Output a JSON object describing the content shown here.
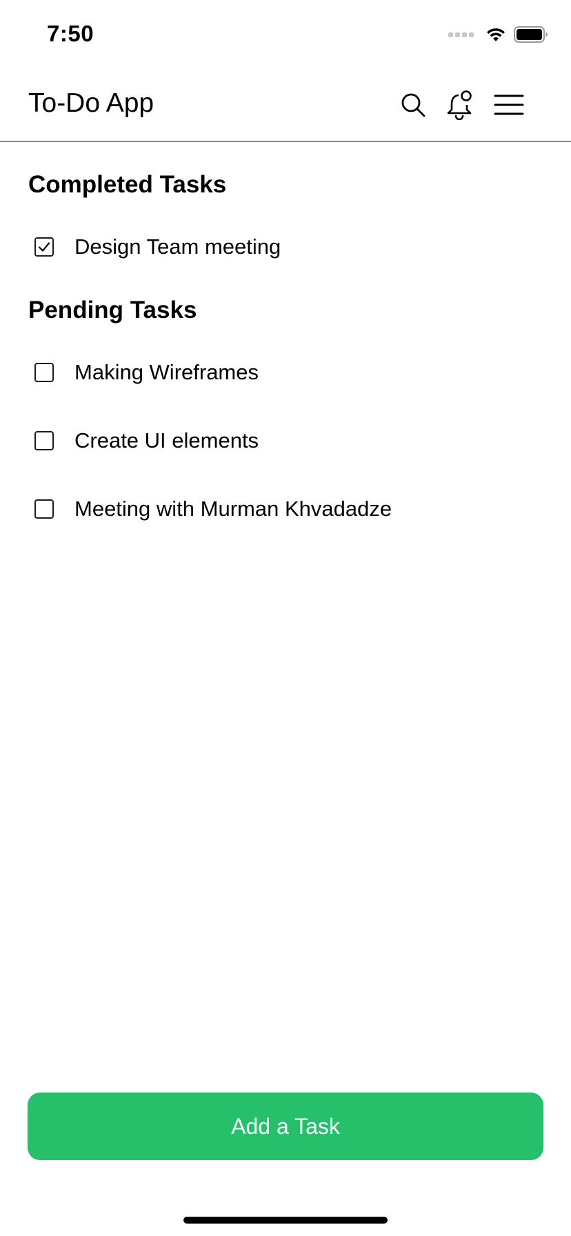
{
  "status_bar": {
    "time": "7:50"
  },
  "header": {
    "title": "To-Do App",
    "icons": [
      "search-icon",
      "bell-icon",
      "menu-icon"
    ]
  },
  "sections": {
    "completed": {
      "title": "Completed Tasks",
      "tasks": [
        {
          "label": "Design Team meeting",
          "checked": true
        }
      ]
    },
    "pending": {
      "title": "Pending Tasks",
      "tasks": [
        {
          "label": "Making Wireframes",
          "checked": false
        },
        {
          "label": "Create UI elements",
          "checked": false
        },
        {
          "label": "Meeting with Murman Khvadadze",
          "checked": false
        }
      ]
    }
  },
  "footer": {
    "add_button_label": "Add a Task"
  },
  "colors": {
    "accent": "#26c06b",
    "divider": "#8a8a8a"
  }
}
